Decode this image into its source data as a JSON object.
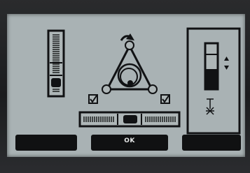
{
  "softkeys": {
    "left": {
      "label": ""
    },
    "center": {
      "label": "OK"
    },
    "right": {
      "label": ""
    }
  },
  "icons": {
    "vertical_level": "vertical-level-vial-icon",
    "rotation": "rotate-arrow-icon",
    "leveling_base": "tribrach-leveling-triangle-icon",
    "checkbox_left": "checkbox-checked-icon",
    "checkbox_right": "checkbox-checked-icon",
    "horizontal_level": "horizontal-level-vial-icon",
    "contrast_gauge": "contrast-gauge-icon",
    "adjust_arrows": "up-down-arrows-icon",
    "laser_plummet": "laser-plummet-icon"
  },
  "colors": {
    "screen": "#a9b2b4",
    "ink": "#111214",
    "bezel": "#1f2022"
  },
  "levels": {
    "vertical_bubble_position": 0.78,
    "horizontal_bubble_position": 0.5,
    "contrast_fill": 0.45
  }
}
